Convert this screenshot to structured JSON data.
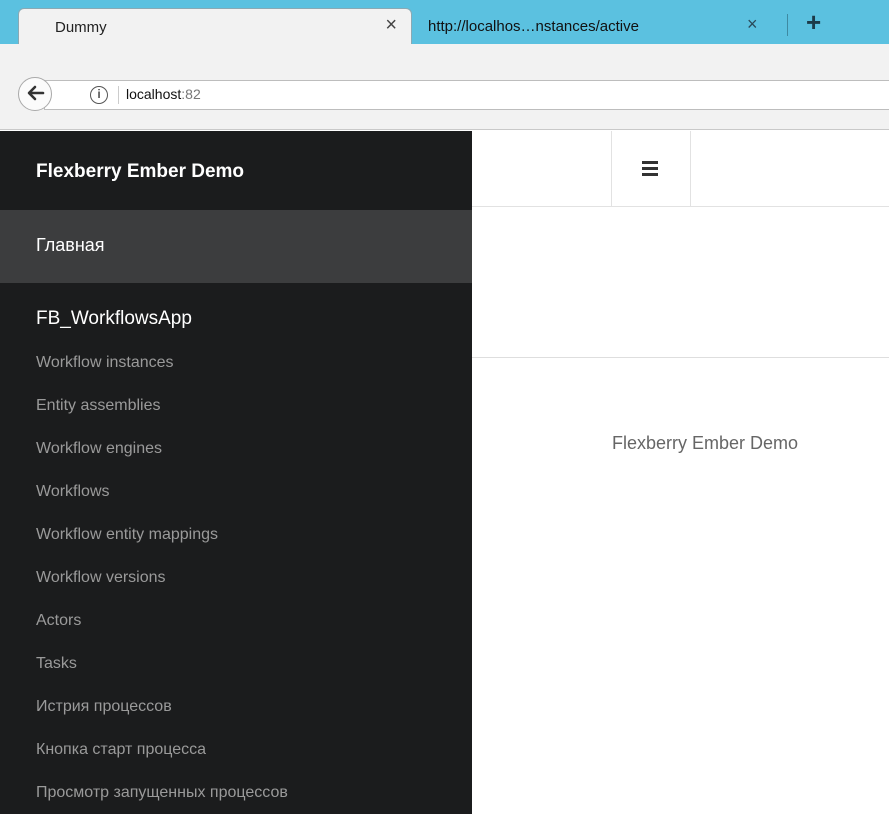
{
  "browser": {
    "tabs": [
      {
        "title": "Dummy",
        "active": true
      },
      {
        "title": "http://localhos…nstances/active",
        "active": false
      }
    ],
    "new_tab_label": "+",
    "close_glyph": "×",
    "address": {
      "host": "localhost",
      "port": ":82"
    },
    "icons": {
      "back": "back-arrow-icon",
      "info": "info-icon",
      "close": "close-icon",
      "new_tab": "plus-icon"
    }
  },
  "app": {
    "brand": "Flexberry Ember Demo",
    "home_link": "Главная",
    "group_title": "FB_WorkflowsApp",
    "nav_items": [
      "Workflow instances",
      "Entity assemblies",
      "Workflow engines",
      "Workflows",
      "Workflow entity mappings",
      "Workflow versions",
      "Actors",
      "Tasks",
      "Истрия процессов",
      "Кнопка старт процесса",
      "Просмотр запущенных процессов"
    ],
    "footer_title": "Flexberry Ember Demo",
    "colors": {
      "sidebar_bg": "#1b1c1d",
      "sidebar_active_bg": "#3c3d3e",
      "sidebar_link": "#9a9a9a",
      "tabstrip_bg": "#5bc1e0"
    }
  }
}
